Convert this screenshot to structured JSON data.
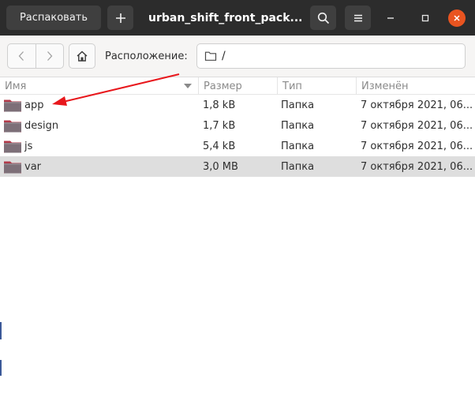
{
  "header": {
    "extract_label": "Распаковать",
    "add_icon": "plus-icon",
    "title": "urban_shift_front_pack...",
    "search_icon": "search-icon",
    "menu_icon": "hamburger-menu-icon",
    "close_color": "#e95420"
  },
  "toolbar": {
    "location_label": "Расположение:",
    "path": "/"
  },
  "columns": {
    "name": "Имя",
    "size": "Размер",
    "type": "Тип",
    "modified": "Изменён"
  },
  "files": [
    {
      "name": "app",
      "size": "1,8 kB",
      "type": "Папка",
      "modified": "7 октября 2021, 06..."
    },
    {
      "name": "design",
      "size": "1,7 kB",
      "type": "Папка",
      "modified": "7 октября 2021, 06..."
    },
    {
      "name": "js",
      "size": "5,4 kB",
      "type": "Папка",
      "modified": "7 октября 2021, 06..."
    },
    {
      "name": "var",
      "size": "3,0 MB",
      "type": "Папка",
      "modified": "7 октября 2021, 06..."
    }
  ],
  "colors": {
    "headerbar": "#2c2c2c",
    "selected_row": "#dedede",
    "annotation_arrow": "#e8171c",
    "folder_body": "#7d6f78",
    "folder_tab": "#b23a4a"
  }
}
